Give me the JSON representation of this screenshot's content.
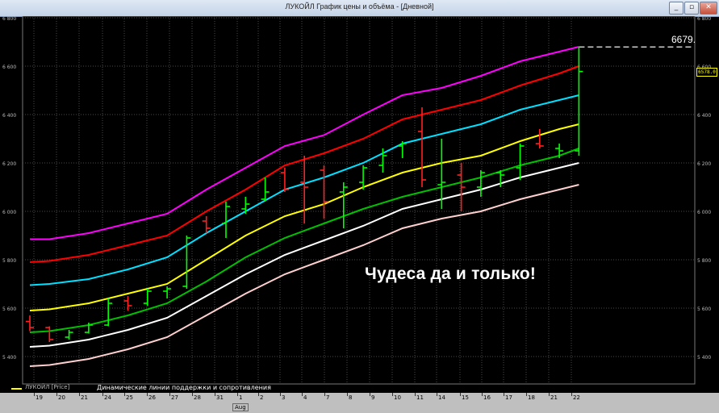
{
  "window": {
    "title": "ЛУКОЙЛ График цены и объёма - [Дневной]",
    "controls": [
      "minimize-icon",
      "restore-icon",
      "close-icon"
    ]
  },
  "chart": {
    "headline": "Чудеса да и только!",
    "last_price_label": "6679.",
    "current_price_label": "6578.0",
    "legend": {
      "series_name": "ЛУКОЙЛ [Price]",
      "description": "Динамические линии поддержки и сопротивления"
    },
    "month_label": "Aug",
    "colors": {
      "background": "#000000",
      "up_bar": "#00ff00",
      "down_bar": "#ff2020",
      "band_outer_upper": "#ff00ff",
      "band_upper": "#ff0000",
      "band_inner_upper": "#00e0ff",
      "band_mid": "#ffff00",
      "band_inner_lower": "#00c000",
      "band_lower": "#ffffff",
      "band_outer_lower": "#ffd0d0",
      "grid": "#4a4a4a"
    }
  },
  "chart_data": {
    "type": "ohlc",
    "title": "ЛУКОЙЛ График цены и объёма",
    "ylim": [
      5300,
      6800
    ],
    "y_ticks": [
      "5 400",
      "5 600",
      "5 800",
      "6 000",
      "6 200",
      "6 400",
      "6 600",
      "6 800"
    ],
    "grid": true,
    "categories": [
      "19",
      "20",
      "21",
      "24",
      "25",
      "26",
      "27",
      "28",
      "31",
      "1",
      "2",
      "3",
      "4",
      "7",
      "8",
      "9",
      "10",
      "11",
      "14",
      "15",
      "16",
      "17",
      "18",
      "21",
      "22"
    ],
    "bars": [
      {
        "o": 5545,
        "h": 5570,
        "l": 5505,
        "c": 5520,
        "dir": "down"
      },
      {
        "o": 5520,
        "h": 5525,
        "l": 5460,
        "c": 5470,
        "dir": "down"
      },
      {
        "o": 5480,
        "h": 5510,
        "l": 5470,
        "c": 5500,
        "dir": "up"
      },
      {
        "o": 5500,
        "h": 5540,
        "l": 5495,
        "c": 5530,
        "dir": "up"
      },
      {
        "o": 5530,
        "h": 5640,
        "l": 5525,
        "c": 5620,
        "dir": "up"
      },
      {
        "o": 5630,
        "h": 5650,
        "l": 5590,
        "c": 5610,
        "dir": "down"
      },
      {
        "o": 5620,
        "h": 5680,
        "l": 5610,
        "c": 5670,
        "dir": "up"
      },
      {
        "o": 5670,
        "h": 5690,
        "l": 5640,
        "c": 5680,
        "dir": "up"
      },
      {
        "o": 5690,
        "h": 5900,
        "l": 5680,
        "c": 5890,
        "dir": "up"
      },
      {
        "o": 5960,
        "h": 5980,
        "l": 5910,
        "c": 5930,
        "dir": "down"
      },
      {
        "o": 5950,
        "h": 6040,
        "l": 5890,
        "c": 6020,
        "dir": "up"
      },
      {
        "o": 6010,
        "h": 6060,
        "l": 5990,
        "c": 6030,
        "dir": "up"
      },
      {
        "o": 6050,
        "h": 6140,
        "l": 6040,
        "c": 6080,
        "dir": "up"
      },
      {
        "o": 6160,
        "h": 6180,
        "l": 6080,
        "c": 6090,
        "dir": "down"
      },
      {
        "o": 6120,
        "h": 6230,
        "l": 5950,
        "c": 6100,
        "dir": "down"
      },
      {
        "o": 6170,
        "h": 6190,
        "l": 5970,
        "c": 6040,
        "dir": "down"
      },
      {
        "o": 6080,
        "h": 6120,
        "l": 5930,
        "c": 6100,
        "dir": "up"
      },
      {
        "o": 6120,
        "h": 6190,
        "l": 6090,
        "c": 6180,
        "dir": "up"
      },
      {
        "o": 6190,
        "h": 6260,
        "l": 6160,
        "c": 6230,
        "dir": "up"
      },
      {
        "o": 6270,
        "h": 6290,
        "l": 6220,
        "c": 6280,
        "dir": "up"
      },
      {
        "o": 6330,
        "h": 6430,
        "l": 6100,
        "c": 6130,
        "dir": "down"
      },
      {
        "o": 6110,
        "h": 6300,
        "l": 6010,
        "c": 6120,
        "dir": "up"
      },
      {
        "o": 6150,
        "h": 6200,
        "l": 6000,
        "c": 6100,
        "dir": "down"
      },
      {
        "o": 6100,
        "h": 6170,
        "l": 6060,
        "c": 6160,
        "dir": "up"
      },
      {
        "o": 6160,
        "h": 6170,
        "l": 6100,
        "c": 6150,
        "dir": "up"
      },
      {
        "o": 6180,
        "h": 6280,
        "l": 6130,
        "c": 6270,
        "dir": "up"
      },
      {
        "o": 6280,
        "h": 6340,
        "l": 6260,
        "c": 6270,
        "dir": "down"
      },
      {
        "o": 6260,
        "h": 6280,
        "l": 6220,
        "c": 6250,
        "dir": "up"
      },
      {
        "o": 6250,
        "h": 6680,
        "l": 6230,
        "c": 6578,
        "dir": "up"
      }
    ],
    "bands_x": [
      0,
      1,
      3,
      5,
      7,
      9,
      11,
      13,
      15,
      17,
      19,
      21,
      23,
      25,
      27,
      28
    ],
    "series": [
      {
        "name": "band-outer-upper",
        "color": "#ff00ff",
        "values": [
          5885,
          5885,
          5910,
          5950,
          5990,
          6090,
          6180,
          6270,
          6315,
          6400,
          6480,
          6510,
          6560,
          6620,
          6660,
          6680
        ]
      },
      {
        "name": "band-upper",
        "color": "#ff0000",
        "values": [
          5790,
          5795,
          5820,
          5860,
          5900,
          6000,
          6090,
          6190,
          6240,
          6300,
          6380,
          6420,
          6460,
          6520,
          6570,
          6600
        ]
      },
      {
        "name": "band-inner-upper",
        "color": "#00e0ff",
        "values": [
          5695,
          5700,
          5720,
          5760,
          5810,
          5910,
          6000,
          6090,
          6140,
          6200,
          6280,
          6320,
          6360,
          6420,
          6460,
          6480
        ]
      },
      {
        "name": "band-mid",
        "color": "#ffff00",
        "values": [
          5590,
          5595,
          5620,
          5660,
          5700,
          5800,
          5900,
          5980,
          6030,
          6100,
          6160,
          6200,
          6230,
          6290,
          6340,
          6360
        ]
      },
      {
        "name": "band-inner-lower",
        "color": "#00c000",
        "values": [
          5500,
          5505,
          5530,
          5570,
          5620,
          5710,
          5810,
          5890,
          5950,
          6010,
          6060,
          6100,
          6140,
          6190,
          6230,
          6260
        ]
      },
      {
        "name": "band-lower",
        "color": "#ffffff",
        "values": [
          5440,
          5445,
          5470,
          5510,
          5560,
          5650,
          5740,
          5820,
          5880,
          5940,
          6010,
          6050,
          6090,
          6140,
          6180,
          6200
        ]
      },
      {
        "name": "band-outer-lower",
        "color": "#ffd0d0",
        "values": [
          5360,
          5365,
          5390,
          5430,
          5480,
          5570,
          5660,
          5740,
          5800,
          5860,
          5930,
          5970,
          6000,
          6050,
          6090,
          6110
        ]
      }
    ],
    "last_price_line": 6679
  }
}
